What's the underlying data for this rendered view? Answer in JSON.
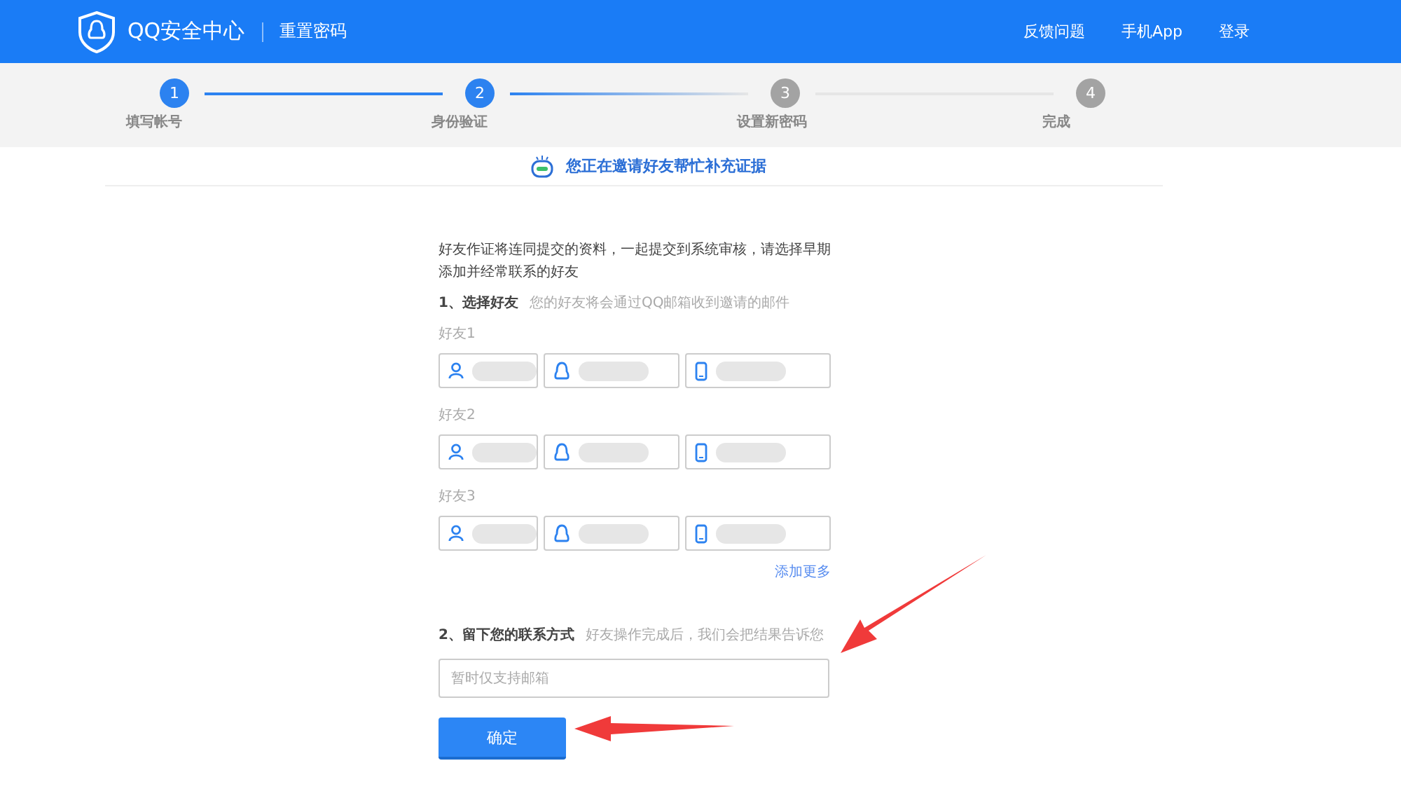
{
  "header": {
    "logo_text": "QQ安全中心",
    "page_title": "重置密码",
    "nav": [
      "反馈问题",
      "手机App",
      "登录"
    ]
  },
  "steps": [
    {
      "number": "1",
      "label": "填写帐号",
      "active": true
    },
    {
      "number": "2",
      "label": "身份验证",
      "active": true
    },
    {
      "number": "3",
      "label": "设置新密码",
      "active": false
    },
    {
      "number": "4",
      "label": "完成",
      "active": false
    }
  ],
  "notice": "您正在邀请好友帮忙补充证据",
  "intro": "好友作证将连同提交的资料，一起提交到系统审核，请选择早期添加并经常联系的好友",
  "section1": {
    "title": "1、选择好友",
    "hint": "您的好友将会通过QQ邮箱收到邀请的邮件"
  },
  "friends": [
    {
      "label": "好友1",
      "fields": [
        {
          "kind": "person"
        },
        {
          "kind": "qq"
        },
        {
          "kind": "phone"
        }
      ]
    },
    {
      "label": "好友2",
      "fields": [
        {
          "kind": "person"
        },
        {
          "kind": "qq"
        },
        {
          "kind": "phone"
        }
      ]
    },
    {
      "label": "好友3",
      "fields": [
        {
          "kind": "person"
        },
        {
          "kind": "qq"
        },
        {
          "kind": "phone"
        }
      ]
    }
  ],
  "add_more": "添加更多",
  "section2": {
    "title": "2、留下您的联系方式",
    "hint": "好友操作完成后，我们会把结果告诉您"
  },
  "contact": {
    "placeholder": "暂时仅支持邮箱"
  },
  "submit": "确定"
}
